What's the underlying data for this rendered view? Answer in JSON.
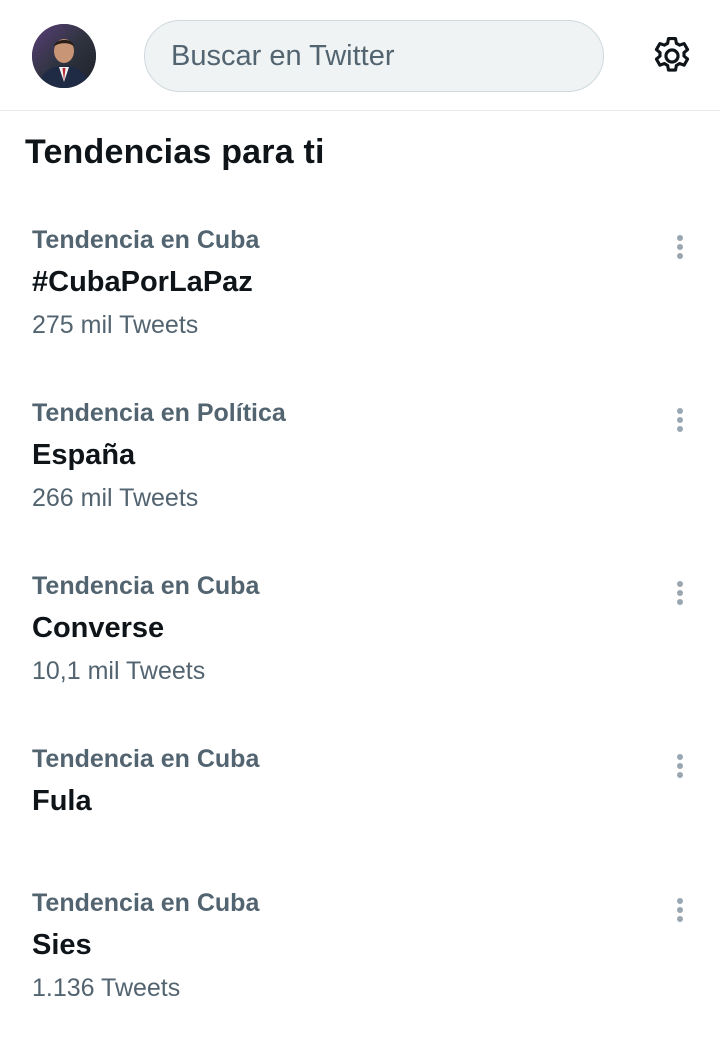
{
  "search": {
    "placeholder": "Buscar en Twitter"
  },
  "section_title": "Tendencias para ti",
  "trends": [
    {
      "context": "Tendencia en Cuba",
      "name": "#CubaPorLaPaz",
      "count": "275 mil Tweets"
    },
    {
      "context": "Tendencia en Política",
      "name": "España",
      "count": "266 mil Tweets"
    },
    {
      "context": "Tendencia en Cuba",
      "name": "Converse",
      "count": "10,1 mil Tweets"
    },
    {
      "context": "Tendencia en Cuba",
      "name": "Fula",
      "count": ""
    },
    {
      "context": "Tendencia en Cuba",
      "name": "Sies",
      "count": "1.136 Tweets"
    }
  ],
  "icons": {
    "avatar": "profile-avatar",
    "settings": "gear-icon",
    "more": "more-vertical-icon"
  },
  "colors": {
    "text_primary": "#0f1419",
    "text_secondary": "#536471",
    "search_bg": "#eff3f4",
    "divider": "#e6e9eb"
  }
}
